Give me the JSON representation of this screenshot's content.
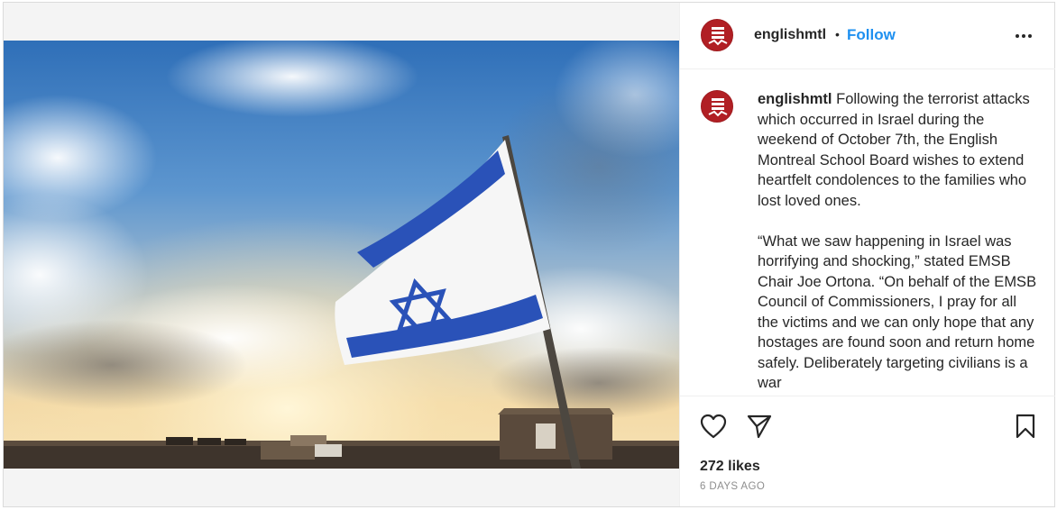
{
  "post": {
    "username": "englishmtl",
    "separator": "•",
    "follow_label": "Follow",
    "more_icon": "more-horizontal-icon",
    "image_description_icon": "flag-photo",
    "caption_paragraphs": [
      "Following the terrorist attacks which occurred in Israel during the weekend of October 7th, the English Montreal School Board wishes to extend heartfelt condolences to the families who lost loved ones.",
      "“What we saw happening in Israel was horrifying and shocking,” stated EMSB Chair Joe Ortona. “On behalf of the EMSB Council of Commissioners, I pray for all the victims and we can only hope that any hostages are found soon and return home safely. Deliberately targeting civilians is a war"
    ],
    "likes": "272 likes",
    "timestamp": "6 DAYS AGO"
  },
  "colors": {
    "brand_red": "#b11f24",
    "follow_blue": "#1e90f0",
    "text": "#262626",
    "muted": "#8e8e8e"
  },
  "icons": {
    "like": "heart-icon",
    "share": "paper-plane-icon",
    "save": "bookmark-icon"
  }
}
